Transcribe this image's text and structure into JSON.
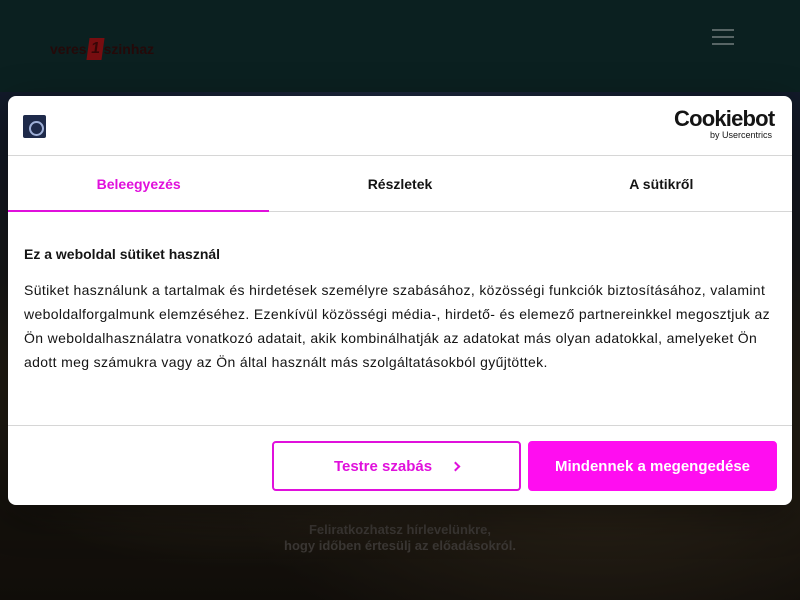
{
  "site": {
    "logo_left": "veres",
    "logo_number": "1",
    "logo_right": "szinhaz",
    "newsletter_line1": "Feliratkozhatsz hírlevelünkre,",
    "newsletter_line2": "hogy időben értesülj az előadásokról."
  },
  "dialog": {
    "brand": "Cookiebot",
    "brand_sub": "by Usercentrics",
    "tabs": [
      {
        "label": "Beleegyezés",
        "active": true
      },
      {
        "label": "Részletek",
        "active": false
      },
      {
        "label": "A sütikről",
        "active": false
      }
    ],
    "heading": "Ez a weboldal sütiket használ",
    "body": "Sütiket használunk a tartalmak és hirdetések személyre szabásához, közösségi funkciók biztosításához, valamint weboldalforgalmunk elemzéséhez. Ezenkívül közösségi média-, hirdető- és elemező partnereinkkel megosztjuk az Ön weboldalhasználatra vonatkozó adatait, akik kombinálhatják az adatokat más olyan adatokkal, amelyeket Ön adott meg számukra vagy az Ön által használt más szolgáltatásokból gyűjtöttek.",
    "customize_label": "Testre szabás",
    "allow_all_label": "Mindennek a megengedése"
  },
  "colors": {
    "accent": "#e010dc",
    "accent_button": "#ff0df0",
    "header_bg": "#123534"
  },
  "icons": {
    "menu": "hamburger-icon",
    "customize_chevron": "chevron-right-icon",
    "site_badge": "site-logo-icon"
  }
}
